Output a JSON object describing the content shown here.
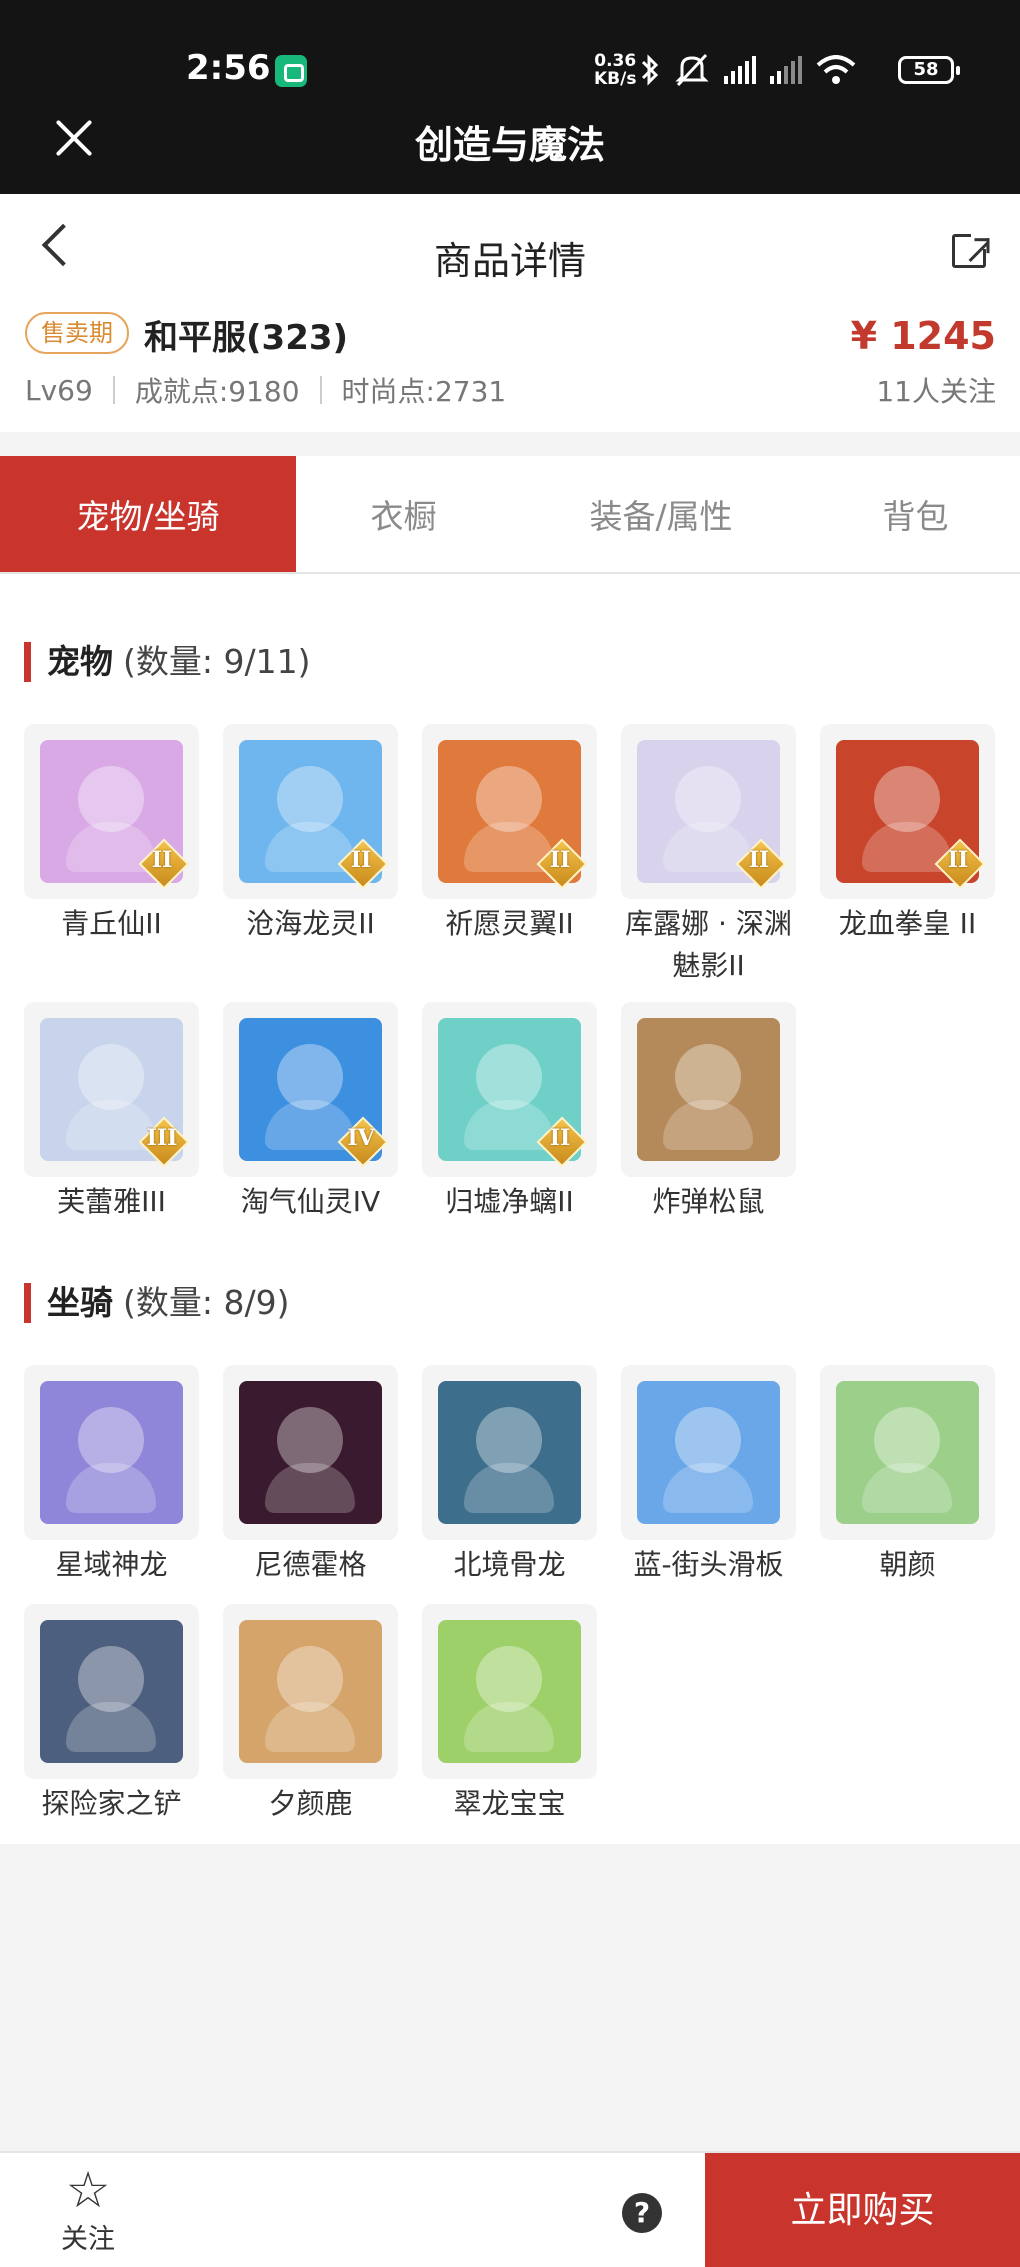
{
  "status_bar": {
    "time": "2:56",
    "net_speed_value": "0.36",
    "net_speed_unit": "KB/s",
    "battery": "58"
  },
  "app": {
    "title": "创造与魔法"
  },
  "detail": {
    "page_title": "商品详情",
    "sale_badge": "售卖期",
    "item_name": "和平服(323)",
    "price": "¥ 1245",
    "level": "Lv69",
    "achievement": "成就点:9180",
    "fashion": "时尚点:2731",
    "followers": "11人关注"
  },
  "tabs": [
    {
      "label": "宠物/坐骑",
      "active": true
    },
    {
      "label": "衣橱",
      "active": false
    },
    {
      "label": "装备/属性",
      "active": false
    },
    {
      "label": "背包",
      "active": false
    }
  ],
  "pets": {
    "title": "宠物",
    "count": "(数量: 9/11)",
    "items": [
      {
        "name": "青丘仙II",
        "rank": "II",
        "color": "#d9a9e6"
      },
      {
        "name": "沧海龙灵II",
        "rank": "II",
        "color": "#6fb6ef"
      },
      {
        "name": "祈愿灵翼II",
        "rank": "II",
        "color": "#e07a3c"
      },
      {
        "name": "库露娜 · 深渊魅影II",
        "rank": "II",
        "color": "#d8d2ec"
      },
      {
        "name": "龙血拳皇 II",
        "rank": "II",
        "color": "#c8452c"
      },
      {
        "name": "芙蕾雅III",
        "rank": "III",
        "color": "#c7d4ec"
      },
      {
        "name": "淘气仙灵IV",
        "rank": "IV",
        "color": "#3d8fe0"
      },
      {
        "name": "归墟净螭II",
        "rank": "II",
        "color": "#6fd0c8"
      },
      {
        "name": "炸弹松鼠",
        "rank": "",
        "color": "#b48a5a"
      }
    ]
  },
  "mounts": {
    "title": "坐骑",
    "count": "(数量: 8/9)",
    "items": [
      {
        "name": "星域神龙",
        "color": "#8f86d9"
      },
      {
        "name": "尼德霍格",
        "color": "#3a1a2e"
      },
      {
        "name": "北境骨龙",
        "color": "#3d6f8c"
      },
      {
        "name": "蓝-街头滑板",
        "color": "#6aa7e8"
      },
      {
        "name": "朝颜",
        "color": "#9ccf8a"
      },
      {
        "name": "探险家之铲",
        "color": "#4d5f7e"
      },
      {
        "name": "夕颜鹿",
        "color": "#d4a46a"
      },
      {
        "name": "翠龙宝宝",
        "color": "#9ed06a"
      }
    ]
  },
  "bottom": {
    "follow_label": "关注",
    "help": "?",
    "buy_label": "立即购买"
  },
  "colors": {
    "accent": "#c9352d",
    "price": "#c23a2e",
    "badge": "#d98b33"
  }
}
